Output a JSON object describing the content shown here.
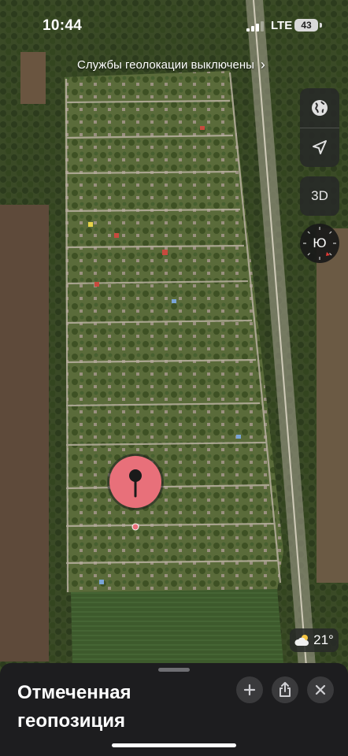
{
  "status_bar": {
    "time": "10:44",
    "network": "LTE",
    "battery": "43"
  },
  "map": {
    "location_services_banner": "Службы геолокации выключены",
    "compass_label": "Ю",
    "view_3d_label": "3D",
    "pin_color": "#e8707a"
  },
  "weather": {
    "temperature": "21°",
    "icon": "partly-cloudy-icon"
  },
  "sheet": {
    "title": "Отмеченная геопозиция",
    "actions": [
      "plus-icon",
      "share-icon",
      "close-icon"
    ]
  }
}
